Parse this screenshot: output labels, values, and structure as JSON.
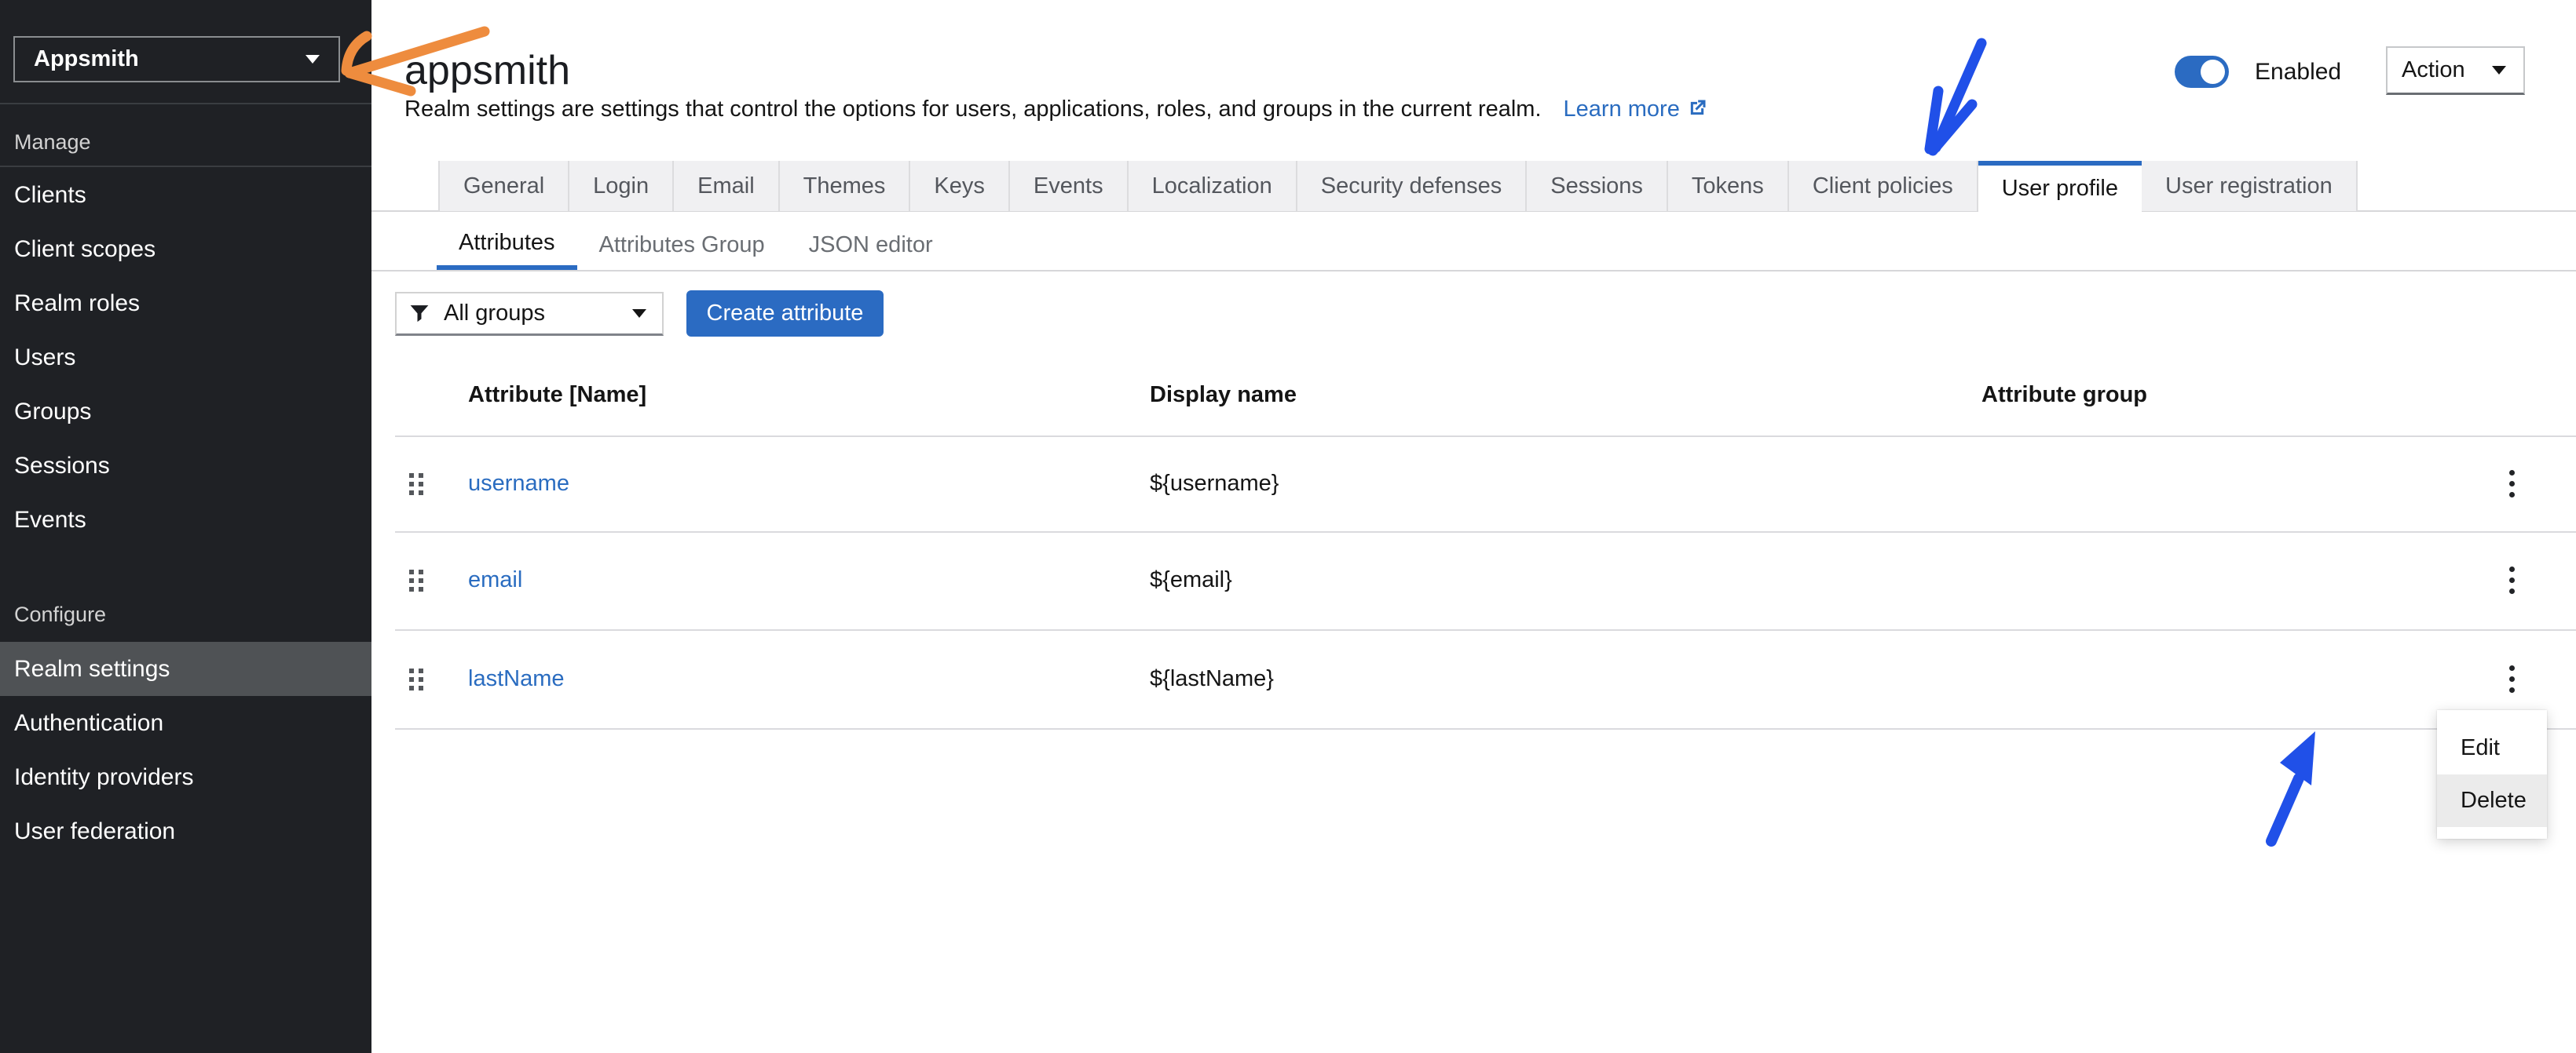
{
  "sidebar": {
    "realm_selector": {
      "value": "Appsmith"
    },
    "sections": [
      {
        "label": "Manage",
        "items": [
          "Clients",
          "Client scopes",
          "Realm roles",
          "Users",
          "Groups",
          "Sessions",
          "Events"
        ]
      },
      {
        "label": "Configure",
        "items": [
          "Realm settings",
          "Authentication",
          "Identity providers",
          "User federation"
        ],
        "selected": "Realm settings"
      }
    ]
  },
  "header": {
    "title": "appsmith",
    "description": "Realm settings are settings that control the options for users, applications, roles, and groups in the current realm.",
    "learn_more_label": "Learn more",
    "enabled_label": "Enabled",
    "enabled_on": true,
    "action_label": "Action"
  },
  "tabs": {
    "items": [
      "General",
      "Login",
      "Email",
      "Themes",
      "Keys",
      "Events",
      "Localization",
      "Security defenses",
      "Sessions",
      "Tokens",
      "Client policies",
      "User profile",
      "User registration"
    ],
    "active": "User profile"
  },
  "subtabs": {
    "items": [
      "Attributes",
      "Attributes Group",
      "JSON editor"
    ],
    "active": "Attributes"
  },
  "toolbar": {
    "filter_value": "All groups",
    "create_label": "Create attribute"
  },
  "table": {
    "columns": [
      "Attribute [Name]",
      "Display name",
      "Attribute group"
    ],
    "rows": [
      {
        "name": "username",
        "display_name": "${username}",
        "attribute_group": ""
      },
      {
        "name": "email",
        "display_name": "${email}",
        "attribute_group": ""
      },
      {
        "name": "lastName",
        "display_name": "${lastName}",
        "attribute_group": ""
      }
    ]
  },
  "context_menu": {
    "items": [
      "Edit",
      "Delete"
    ],
    "highlighted": "Delete"
  },
  "icons": {
    "realm_selector": "caret-down-icon",
    "learn_more": "external-link-icon",
    "filter": "funnel-icon",
    "filter_caret": "caret-down-icon",
    "action_caret": "caret-down-icon",
    "row_drag": "drag-grip-icon",
    "row_actions": "kebab-menu-icon"
  },
  "annotations": [
    {
      "name": "orange-arrow",
      "points_at": "realm-selector",
      "color": "#ee8c3e"
    },
    {
      "name": "blue-arrow-tab",
      "points_at": "tab-user-profile",
      "color": "#2050e8"
    },
    {
      "name": "blue-arrow-menu",
      "points_at": "context-menu",
      "color": "#2050e8"
    }
  ],
  "colors": {
    "primary": "#2b6bc2",
    "link": "#2a6cc0",
    "sidebar_bg": "#1f2125",
    "sidebar_selected": "#4f5255",
    "tab_bg": "#f0f0f2",
    "menu_highlight": "#ebebeb",
    "arrow_orange": "#ee8c3e",
    "arrow_blue": "#2050e8"
  }
}
